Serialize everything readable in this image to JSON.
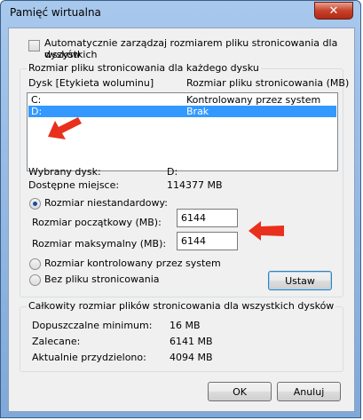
{
  "window": {
    "title": "Pamięć wirtualna",
    "close_label": "✕"
  },
  "auto_manage": {
    "checked": false,
    "label_line1": "Automatycznie zarządzaj rozmiarem pliku stronicowania dla wszystkich",
    "label_line2": "dysków"
  },
  "per_drive": {
    "group_title": "Rozmiar pliku stronicowania dla każdego dysku",
    "col_drive": "Dysk [Etykieta woluminu]",
    "col_size": "Rozmiar pliku stronicowania (MB)",
    "drives": [
      {
        "drive": "C:",
        "size": "Kontrolowany przez system",
        "selected": false
      },
      {
        "drive": "D:",
        "size": "Brak",
        "selected": true
      }
    ],
    "selected_drive_label": "Wybrany dysk:",
    "selected_drive_value": "D:",
    "free_space_label": "Dostępne miejsce:",
    "free_space_value": "114377 MB",
    "custom_size_label": "Rozmiar niestandardowy:",
    "initial_size_label": "Rozmiar początkowy (MB):",
    "initial_size_value": "6144",
    "max_size_label": "Rozmiar maksymalny (MB):",
    "max_size_value": "6144",
    "system_managed_label": "Rozmiar kontrolowany przez system",
    "no_paging_label": "Bez pliku stronicowania",
    "selected_option": "custom",
    "set_button": "Ustaw"
  },
  "totals": {
    "group_title": "Całkowity rozmiar plików stronicowania dla wszystkich dysków",
    "min_label": "Dopuszczalne minimum:",
    "min_value": "16 MB",
    "recommended_label": "Zalecane:",
    "recommended_value": "6141 MB",
    "allocated_label": "Aktualnie przydzielono:",
    "allocated_value": "4094 MB"
  },
  "buttons": {
    "ok": "OK",
    "cancel": "Anuluj"
  },
  "colors": {
    "annotation_arrow": "#e8301c",
    "selection": "#3399ff"
  }
}
